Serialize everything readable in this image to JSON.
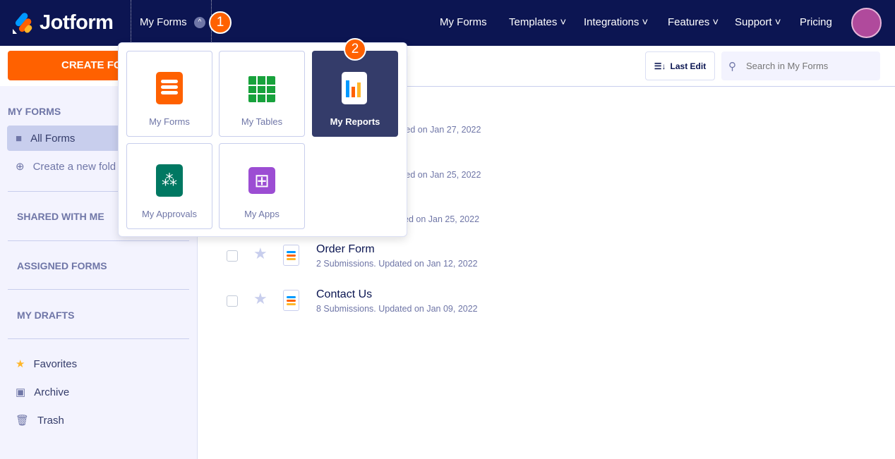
{
  "header": {
    "brand": "Jotform",
    "nav_dropdown_label": "My Forms",
    "step1": "1",
    "step2": "2",
    "nav": [
      "My Forms",
      "Templates",
      "Integrations",
      "Features",
      "Support",
      "Pricing"
    ]
  },
  "toolbar": {
    "create_label": "CREATE FORM",
    "visible_create": "CREATE FO",
    "sort_label": "Last Edit",
    "search_placeholder": "Search in My Forms"
  },
  "sidebar": {
    "section_my_forms": "MY FORMS",
    "all_forms": "All Forms",
    "create_folder": "Create a new fold",
    "shared": "SHARED WITH ME",
    "assigned": "ASSIGNED FORMS",
    "drafts": "MY DRAFTS",
    "favorites": "Favorites",
    "archive": "Archive",
    "trash": "Trash"
  },
  "dropdown": {
    "tiles": [
      "My Forms",
      "My Tables",
      "My Reports",
      "My Approvals",
      "My Apps"
    ],
    "selected": "My Reports"
  },
  "forms": {
    "partial_subs": [
      "ated on Jan 27, 2022",
      "ated on Jan 25, 2022",
      "ed on Jan 25, 2022"
    ],
    "rows": [
      {
        "title": "Order Form",
        "sub": "2 Submissions. Updated on Jan 12, 2022"
      },
      {
        "title": "Contact Us",
        "sub": "8 Submissions. Updated on Jan 09, 2022"
      }
    ]
  },
  "colors": {
    "header": "#0c1552",
    "accent": "#ff6100",
    "selected_tile": "#343c6a"
  }
}
